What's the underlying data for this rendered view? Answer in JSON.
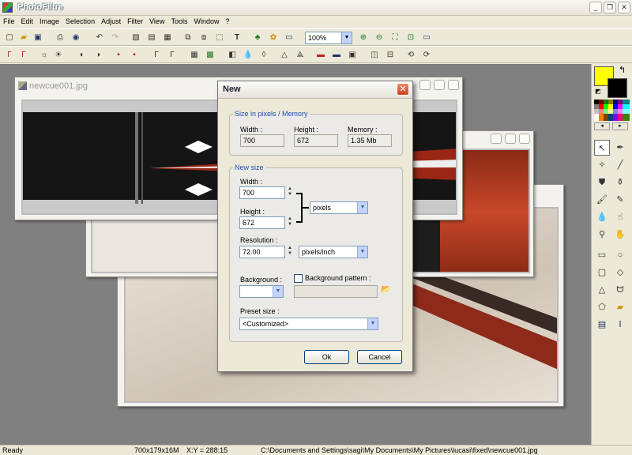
{
  "app": {
    "title": "PhotoFiltre",
    "controls": {
      "minimize": "_",
      "restore": "❐",
      "close": "✕"
    }
  },
  "menu": [
    "File",
    "Edit",
    "Image",
    "Selection",
    "Adjust",
    "Filter",
    "View",
    "Tools",
    "Window",
    "?"
  ],
  "toolbar": {
    "zoom": "100%"
  },
  "documents": [
    {
      "title": "newcue001.jpg"
    }
  ],
  "dialog": {
    "title": "New",
    "close_label": "✕",
    "size_memory": {
      "legend": "Size in pixels / Memory",
      "width_label": "Width :",
      "width_value": "700",
      "height_label": "Height :",
      "height_value": "672",
      "memory_label": "Memory :",
      "memory_value": "1.35 Mb"
    },
    "new_size": {
      "legend": "New size",
      "width_label": "Width :",
      "width_value": "700",
      "height_label": "Height :",
      "height_value": "672",
      "unit": "pixels",
      "resolution_label": "Resolution :",
      "resolution_value": "72.00",
      "resolution_unit": "pixels/inch",
      "background_label": "Background :",
      "background_pattern_label": "Background pattern :",
      "background_pattern_checked": false,
      "preset_label": "Preset size :",
      "preset_value": "<Customized>"
    },
    "ok_label": "Ok",
    "cancel_label": "Cancel"
  },
  "colors": {
    "foreground": "#ffff00",
    "background": "#000000",
    "titlebar_close": "#c8411c"
  },
  "status": {
    "ready": "Ready",
    "dimensions": "700x179x16M",
    "coords": "X:Y = 288:15",
    "path": "C:\\Documents and Settings\\sagi\\My Documents\\My Pictures\\lucasi\\fixed\\newcue001.jpg"
  }
}
